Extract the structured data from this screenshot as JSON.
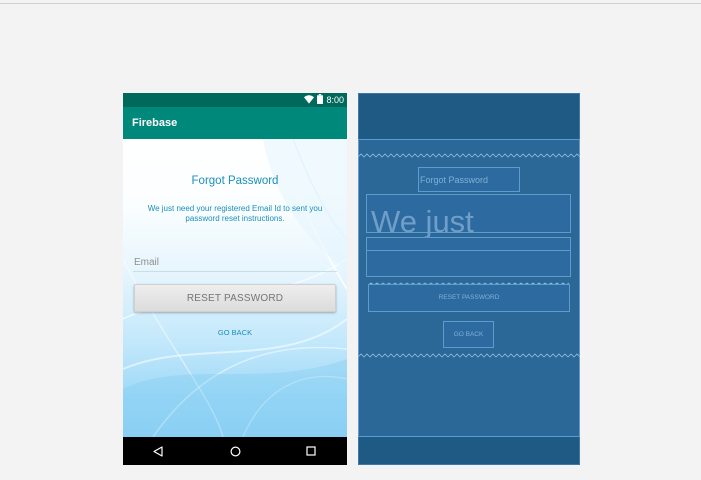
{
  "colors": {
    "status_bar": "#00695c",
    "app_bar": "#00897b",
    "accent_text": "#1a8fb8",
    "button_bg": "#e3e3e3",
    "blueprint_bg": "#1f5a84",
    "blueprint_line": "#5d9ccc"
  },
  "status_bar": {
    "time": "8:00",
    "icons": [
      "wifi-icon",
      "battery-icon"
    ]
  },
  "app_bar": {
    "title": "Firebase"
  },
  "forgot_password": {
    "title": "Forgot Password",
    "description": "We just need your registered Email Id to sent you password reset instructions.",
    "email_placeholder": "Email",
    "reset_button": "RESET PASSWORD",
    "go_back_button": "GO BACK"
  },
  "nav_bar": {
    "icons": [
      "back-icon",
      "home-icon",
      "recents-icon"
    ]
  },
  "blueprint": {
    "title_label": "Forgot Password",
    "description_label": "We just",
    "reset_label": "RESET PASSWORD",
    "go_back_label": "GO BACK"
  }
}
